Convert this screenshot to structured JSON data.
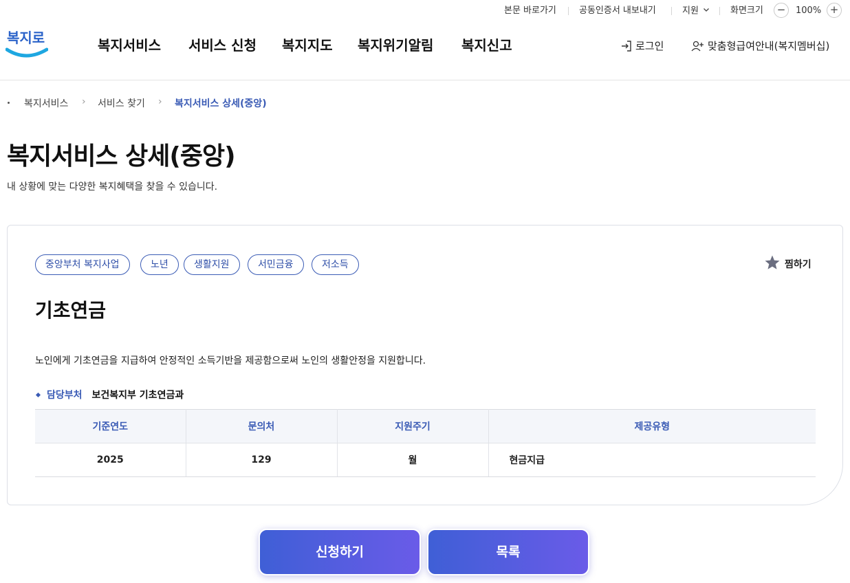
{
  "utility": {
    "skip_link": "본문 바로가기",
    "cert_export": "공동인증서 내보내기",
    "support": "지원",
    "screen_size": "화면크기",
    "zoom_minus": "−",
    "zoom_level": "100%",
    "zoom_plus": "+"
  },
  "logo": {
    "text": "복지로",
    "color": "#1ea7e1",
    "accent": "#2a62c9"
  },
  "nav": {
    "items": [
      "복지서비스",
      "서비스 신청",
      "복지지도",
      "복지위기알림",
      "복지신고"
    ]
  },
  "header_links": {
    "login": "로그인",
    "membership": "맞춤형급여안내(복지멤버십)"
  },
  "breadcrumb": [
    "복지서비스",
    "서비스 찾기",
    "복지서비스 상세(중앙)"
  ],
  "page": {
    "title": "복지서비스 상세(중앙)",
    "subtitle": "내 상황에 맞는 다양한 복지혜택을 찾을 수 있습니다."
  },
  "service": {
    "tags": [
      "중앙부처 복지사업",
      "노년",
      "생활지원",
      "서민금융",
      "저소득"
    ],
    "favorite_label": "찜하기",
    "name": "기초연금",
    "description": "노인에게 기초연금을 지급하여 안정적인 소득기반을 제공함으로써 노인의 생활안정을 지원합니다.",
    "dept_label": "담당부처",
    "dept_value": "보건복지부 기초연금과",
    "table": {
      "headers": [
        "기준연도",
        "문의처",
        "지원주기",
        "제공유형"
      ],
      "row": [
        "2025",
        "129",
        "월",
        "현금지급"
      ]
    }
  },
  "buttons": {
    "apply": "신청하기",
    "list": "목록"
  },
  "colors": {
    "accent": "#3a5bb5",
    "button_start": "#3f5fd6",
    "button_end": "#6a5be8"
  }
}
